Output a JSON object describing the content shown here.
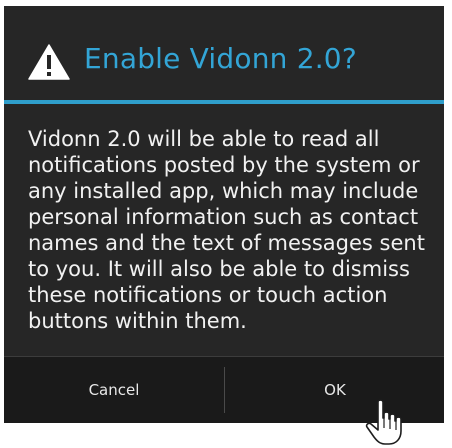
{
  "dialog": {
    "title": "Enable Vidonn 2.0?",
    "title_icon": "warning-icon",
    "message_lines": [
      "Vidonn 2.0 will be able to read all",
      "notifications posted by the system or",
      "any installed app, which may include",
      "personal information such as contact",
      "names and the text of messages sent",
      "to you. It will also be able to dismiss",
      "these notifications or touch action",
      "buttons within them."
    ],
    "buttons": {
      "cancel_label": "Cancel",
      "ok_label": "OK"
    }
  },
  "cursor_icon": "hand-pointer-icon",
  "colors": {
    "dialog_background": "#262626",
    "title": "#33a5d6",
    "divider": "#2f9ecb",
    "text": "#f1f1f1",
    "button_bar": "#1a1a1a"
  }
}
